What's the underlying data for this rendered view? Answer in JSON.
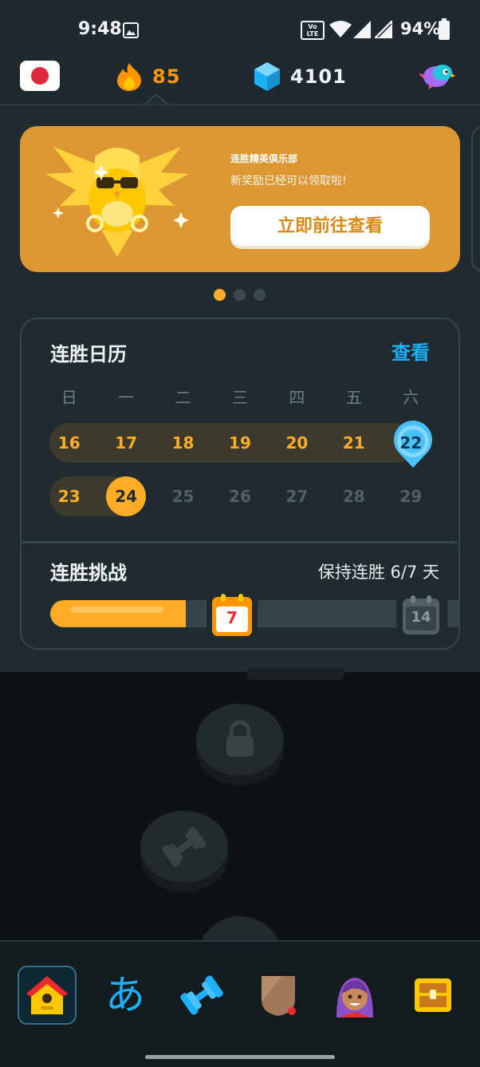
{
  "status_bar": {
    "time": "9:48",
    "network_badge": "Vo LTE",
    "battery": "94%"
  },
  "top_bar": {
    "language_flag": "japan-flag",
    "streak_count": "85",
    "gems_count": "4101"
  },
  "banner": {
    "club_name": "连胜精英俱乐部",
    "reward_text": "新奖励已经可以领取啦!",
    "button_label": "立即前往查看",
    "page_count": 3,
    "active_page": 0
  },
  "calendar": {
    "title": "连胜日历",
    "view_label": "查看",
    "weekdays": [
      "日",
      "一",
      "二",
      "三",
      "四",
      "五",
      "六"
    ],
    "week1": [
      "16",
      "17",
      "18",
      "19",
      "20",
      "21",
      "22"
    ],
    "week2": [
      "23",
      "24",
      "25",
      "26",
      "27",
      "28",
      "29"
    ],
    "today": "24",
    "freeze_day": "22"
  },
  "challenge": {
    "title": "连胜挑战",
    "status": "保持连胜 6/7 天",
    "progress": 0.857,
    "milestones": [
      "7",
      "14"
    ]
  },
  "colors": {
    "accent_orange": "#ffad27",
    "accent_blue": "#1cb0f6",
    "banner_bg": "#dc9632",
    "panel_bg": "#202b30"
  },
  "bottom_nav": {
    "kana_glyph": "あ",
    "items": [
      "home-icon",
      "characters-icon",
      "practice-icon",
      "leagues-icon",
      "profile-icon",
      "shop-icon"
    ]
  }
}
